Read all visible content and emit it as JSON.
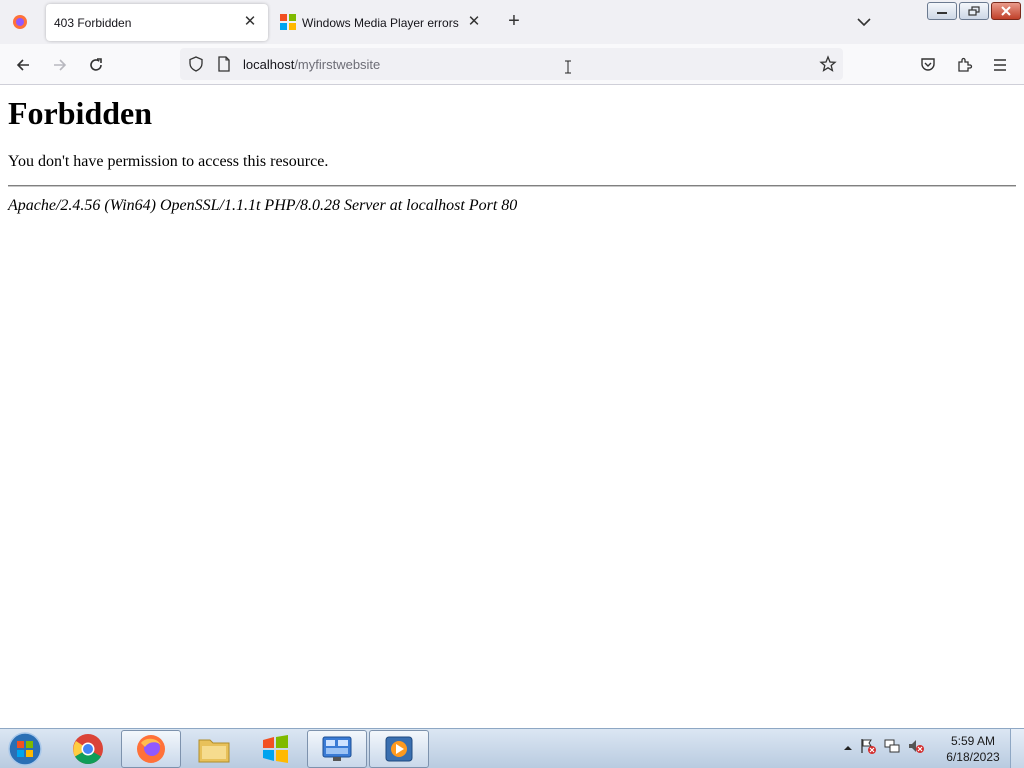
{
  "browser": {
    "tabs": [
      {
        "title": "403 Forbidden",
        "active": true
      },
      {
        "title": "Windows Media Player errors - ",
        "active": false
      }
    ],
    "url": {
      "host": "localhost",
      "path": "/myfirstwebsite"
    }
  },
  "page": {
    "heading": "Forbidden",
    "message": "You don't have permission to access this resource.",
    "server_signature": "Apache/2.4.56 (Win64) OpenSSL/1.1.1t PHP/8.0.28 Server at localhost Port 80"
  },
  "taskbar": {
    "items": [
      "start-orb",
      "chrome-icon",
      "firefox-icon",
      "file-explorer-icon",
      "media-player-icon",
      "control-panel-icon",
      "video-player-icon"
    ],
    "clock": {
      "time": "5:59 AM",
      "date": "6/18/2023"
    }
  },
  "colors": {
    "tab_bg": "#f0f0f4",
    "navbar_bg": "#f9f9fb",
    "taskbar_top": "#dbe6f3",
    "taskbar_bottom": "#b9cbe0",
    "accent": "#0061e0"
  }
}
